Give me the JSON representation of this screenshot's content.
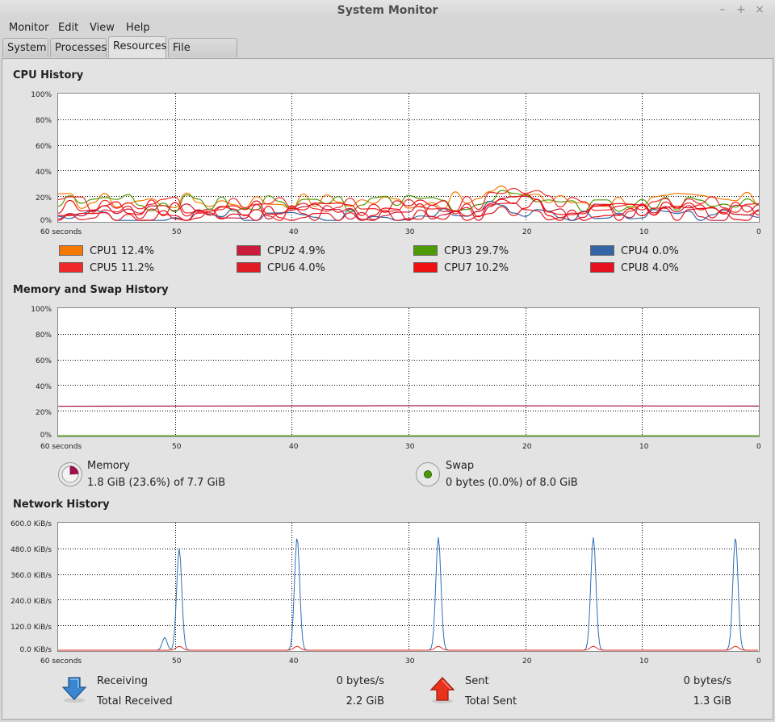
{
  "window": {
    "title": "System Monitor",
    "controls": {
      "minimize": "–",
      "maximize": "+",
      "close": "×"
    }
  },
  "menu": [
    "Monitor",
    "Edit",
    "View",
    "Help"
  ],
  "tabs": [
    {
      "label": "System",
      "active": false
    },
    {
      "label": "Processes",
      "active": false
    },
    {
      "label": "Resources",
      "active": true
    },
    {
      "label": "File Systems",
      "active": false
    }
  ],
  "x_axis_labels": [
    "60 seconds",
    "50",
    "40",
    "30",
    "20",
    "10",
    "0"
  ],
  "cpu": {
    "title": "CPU History",
    "y_axis_labels": [
      "100%",
      "80%",
      "60%",
      "40%",
      "20%",
      "0%"
    ],
    "cores": [
      {
        "name": "CPU1",
        "value": "12.4%",
        "color": "#f57900"
      },
      {
        "name": "CPU2",
        "value": "4.9%",
        "color": "#cc1a3a"
      },
      {
        "name": "CPU3",
        "value": "29.7%",
        "color": "#4e9a06"
      },
      {
        "name": "CPU4",
        "value": "0.0%",
        "color": "#3465a4"
      },
      {
        "name": "CPU5",
        "value": "11.2%",
        "color": "#ef2929"
      },
      {
        "name": "CPU6",
        "value": "4.0%",
        "color": "#e01b24"
      },
      {
        "name": "CPU7",
        "value": "10.2%",
        "color": "#f01010"
      },
      {
        "name": "CPU8",
        "value": "4.0%",
        "color": "#e8101c"
      }
    ]
  },
  "memory": {
    "title": "Memory and Swap History",
    "y_axis_labels": [
      "100%",
      "80%",
      "60%",
      "40%",
      "20%",
      "0%"
    ],
    "memory_label": "Memory",
    "memory_value": "1.8 GiB (23.6%) of 7.7 GiB",
    "memory_percent": 23.6,
    "memory_color": "#a40e4c",
    "swap_label": "Swap",
    "swap_value": "0 bytes (0.0%) of 8.0 GiB",
    "swap_percent": 0.0,
    "swap_color": "#4e9a06"
  },
  "network": {
    "title": "Network History",
    "y_axis_labels": [
      "600.0 KiB/s",
      "480.0 KiB/s",
      "360.0 KiB/s",
      "240.0 KiB/s",
      "120.0 KiB/s",
      "0.0 KiB/s"
    ],
    "receiving_label": "Receiving",
    "receiving_value": "0 bytes/s",
    "total_received_label": "Total Received",
    "total_received_value": "2.2 GiB",
    "sent_label": "Sent",
    "sent_value": "0 bytes/s",
    "total_sent_label": "Total Sent",
    "total_sent_value": "1.3 GiB",
    "receiving_color": "#2d6fb4",
    "sent_color": "#e32b1a"
  }
}
